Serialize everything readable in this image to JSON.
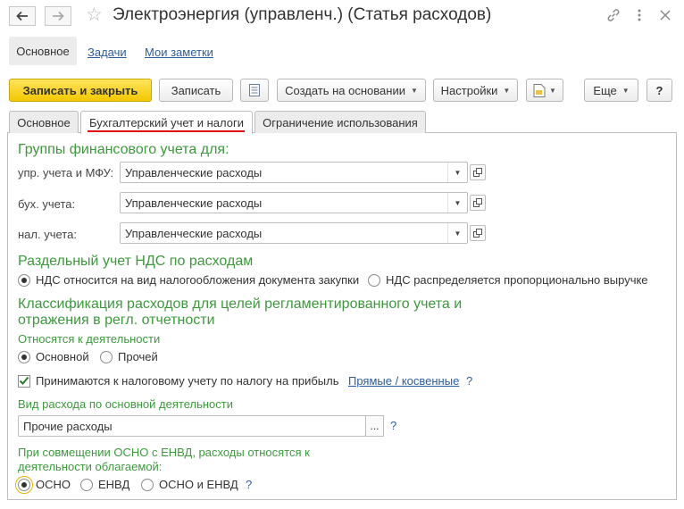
{
  "window": {
    "title": "Электроэнергия (управленч.) (Статья расходов)"
  },
  "nav": {
    "main": "Основное",
    "tasks": "Задачи",
    "notes": "Мои заметки"
  },
  "toolbar": {
    "save_close": "Записать и закрыть",
    "save": "Записать",
    "create_based": "Создать на основании",
    "settings": "Настройки",
    "more": "Еще",
    "help": "?"
  },
  "tabs": [
    {
      "label": "Основное"
    },
    {
      "label": "Бухгалтерский учет и налоги"
    },
    {
      "label": "Ограничение использования"
    }
  ],
  "fin_groups": {
    "heading": "Группы финансового учета для:",
    "rows": [
      {
        "label": "упр. учета и МФУ:",
        "value": "Управленческие расходы"
      },
      {
        "label": "бух. учета:",
        "value": "Управленческие расходы"
      },
      {
        "label": "нал. учета:",
        "value": "Управленческие расходы"
      }
    ]
  },
  "vat": {
    "heading": "Раздельный учет НДС по расходам",
    "option1": "НДС относится на вид налогообложения документа закупки",
    "option2": "НДС распределяется пропорционально выручке"
  },
  "classification": {
    "heading_line1": "Классификация расходов для целей регламентированного учета и",
    "heading_line2": "отражения в регл. отчетности",
    "activity_label": "Относятся к деятельности",
    "activity_main": "Основной",
    "activity_other": "Прочей",
    "tax_checkbox": "Принимаются к налоговому учету по налогу на прибыль",
    "direct_indirect": "Прямые / косвенные",
    "hint": "?",
    "expense_kind_label": "Вид расхода по основной деятельности",
    "expense_kind_value": "Прочие расходы",
    "browse": "...",
    "combo_line1": "При совмещении ОСНО с ЕНВД, расходы относятся к",
    "combo_line2": "деятельности облагаемой:",
    "opt_osno": "ОСНО",
    "opt_envd": "ЕНВД",
    "opt_both": "ОСНО и ЕНВД"
  }
}
